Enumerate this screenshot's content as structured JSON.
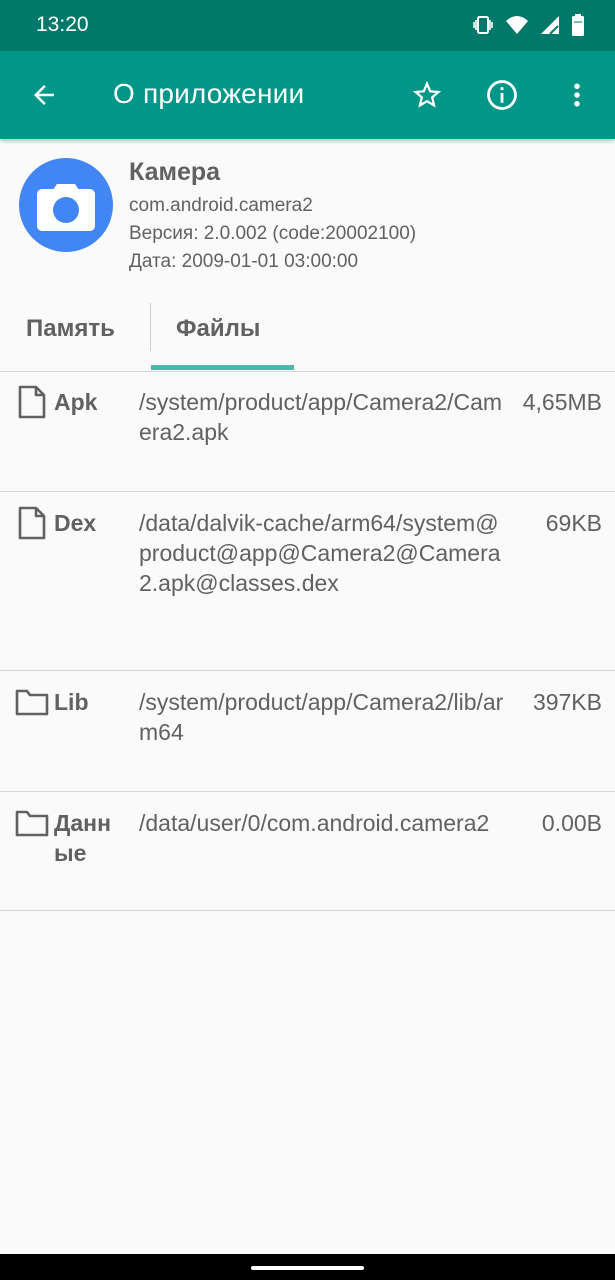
{
  "status_bar": {
    "time": "13:20",
    "icons": [
      "vibrate-icon",
      "wifi-icon",
      "signal-icon",
      "battery-icon"
    ]
  },
  "app_bar": {
    "title": "О приложении",
    "actions": [
      "back-arrow-icon",
      "star-icon",
      "info-icon",
      "more-vert-icon"
    ]
  },
  "app": {
    "name": "Камера",
    "package": "com.android.camera2",
    "version": "Версия: 2.0.002 (code:20002100)",
    "date": "Дата: 2009-01-01 03:00:00"
  },
  "tabs": [
    {
      "label": "Память",
      "selected": false
    },
    {
      "label": "Файлы",
      "selected": true
    }
  ],
  "files": [
    {
      "icon": "file-icon",
      "label": "Apk",
      "path": "/system/product/app/Camera2/Camera2.apk",
      "size": "4,65MB"
    },
    {
      "icon": "file-icon",
      "label": "Dex",
      "path": "/data/dalvik-cache/arm64/system@product@app@Camera2@Camera2.apk@classes.dex",
      "size": "69KB"
    },
    {
      "icon": "folder-icon",
      "label": "Lib",
      "path": "/system/product/app/Camera2/lib/arm64",
      "size": "397KB"
    },
    {
      "icon": "folder-icon",
      "label": "Данные",
      "path": "/data/user/0/com.android.camera2",
      "size": "0.00B"
    }
  ],
  "colors": {
    "status_bar": "#00796b",
    "app_bar": "#009688",
    "tab_indicator": "#4db6ac",
    "app_icon": "#4285f4"
  }
}
